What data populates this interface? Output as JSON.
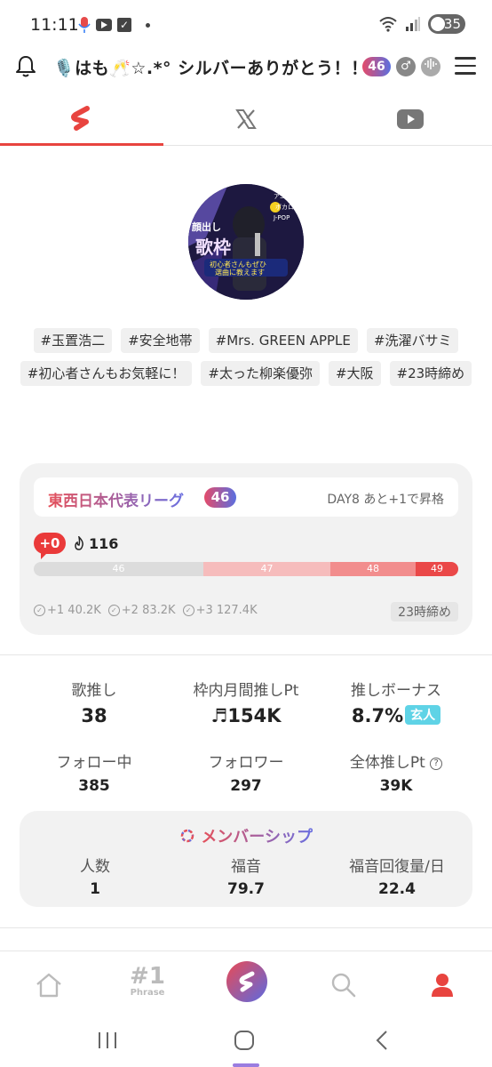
{
  "status_bar": {
    "time": "11:11",
    "battery": "35"
  },
  "header": {
    "title": "🎙️はも🥂☆.*° シルバーありがとう！！",
    "level_badge": "46",
    "gender_symbol": "♂"
  },
  "tabs": [
    {
      "label": "",
      "icon": "app-logo-icon",
      "active": true
    },
    {
      "label": "",
      "icon": "x-logo-icon",
      "active": false
    },
    {
      "label": "",
      "icon": "youtube-icon",
      "active": false
    }
  ],
  "profile": {
    "avatar_text": [
      "顔出し",
      "歌枠",
      "アニメ",
      "ボカロ",
      "J-POP",
      "初心者さんもぜひ",
      "選曲に教えます"
    ],
    "hashtags": [
      "#玉置浩二",
      "#安全地帯",
      "#Mrs. GREEN APPLE",
      "#洗濯バサミ",
      "#初心者さんもお気軽に！",
      "#太った柳楽優弥",
      "#大阪",
      "#23時締め"
    ]
  },
  "league": {
    "title": "東西日本代表リーグ",
    "badge": "46",
    "day_text": "DAY8 あと+1で昇格",
    "plus_badge": "+0",
    "flame_count": "116",
    "segments": [
      {
        "label": "46",
        "color": "#dcdcdc",
        "fraction": 0.4
      },
      {
        "label": "47",
        "color": "#f6bcbc",
        "fraction": 0.3
      },
      {
        "label": "48",
        "color": "#f28d8d",
        "fraction": 0.2
      },
      {
        "label": "49",
        "color": "#ea4848",
        "fraction": 0.1
      }
    ],
    "milestones": [
      "+1 40.2K",
      "+2 83.2K",
      "+3 127.4K"
    ],
    "deadline": "23時締め"
  },
  "stats": {
    "song_push_label": "歌推し",
    "song_push_value": "38",
    "monthly_label": "枠内月間推しPt",
    "monthly_value": "♬154K",
    "bonus_label": "推しボーナス",
    "bonus_value": "8.7%",
    "bonus_tag": "玄人",
    "following_label": "フォロー中",
    "following_value": "385",
    "followers_label": "フォロワー",
    "followers_value": "297",
    "total_label": "全体推しPt",
    "total_value": "39K"
  },
  "membership": {
    "title": "メンバーシップ",
    "members_label": "人数",
    "members_value": "1",
    "gospel_label": "福音",
    "gospel_value": "79.7",
    "recovery_label": "福音回復量/日",
    "recovery_value": "22.4"
  },
  "bottom_nav": {
    "phrase_rank": "#1",
    "phrase_label": "Phrase"
  },
  "colors": {
    "accent": "#e8443f",
    "gradient_start": "#e5505a",
    "gradient_end": "#6a6fe0",
    "card_bg": "#f2f2f2"
  }
}
